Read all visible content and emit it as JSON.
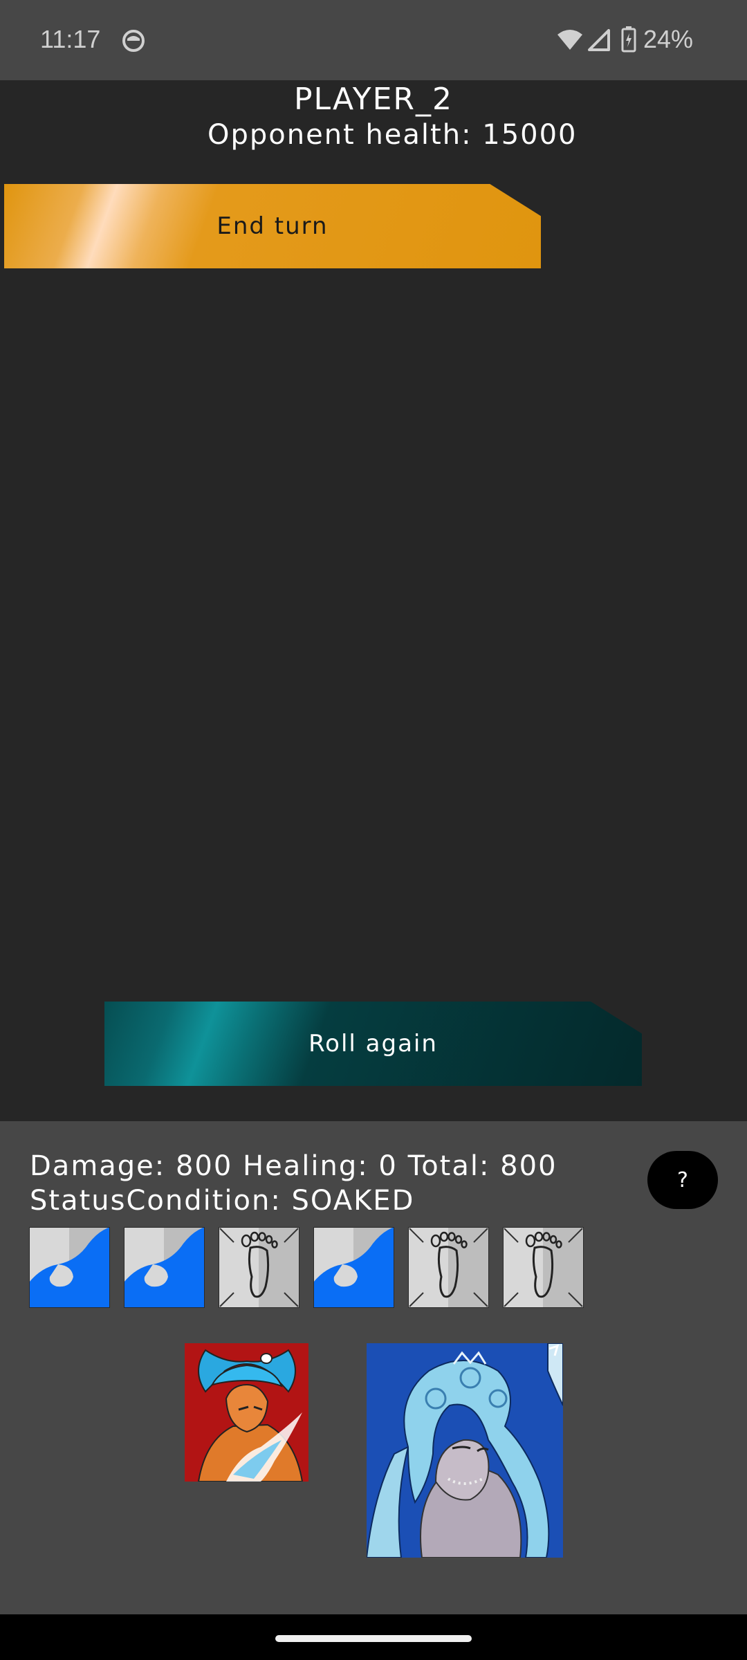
{
  "status_bar": {
    "time": "11:17",
    "battery": "24%",
    "icons": [
      "app-notification-icon",
      "wifi-icon",
      "cell-signal-icon",
      "battery-charging-icon"
    ]
  },
  "header": {
    "player_name": "PLAYER_2",
    "opponent_health": "Opponent health: 15000"
  },
  "buttons": {
    "end_turn": "End turn",
    "roll_again": "Roll again",
    "help": "?"
  },
  "colors": {
    "gold": "#e0950f",
    "teal": "#0f9299",
    "water_blue": "#0a6ef5",
    "panel": "#474747",
    "background": "#262626"
  },
  "roll": {
    "summary": "Damage: 800 Healing: 0 Total: 800",
    "status_condition": "StatusCondition: SOAKED",
    "dice": [
      "wave-icon",
      "wave-icon",
      "foot-icon",
      "wave-icon",
      "foot-icon",
      "foot-icon"
    ]
  },
  "portraits": [
    "character-portrait-red",
    "character-portrait-blue"
  ]
}
